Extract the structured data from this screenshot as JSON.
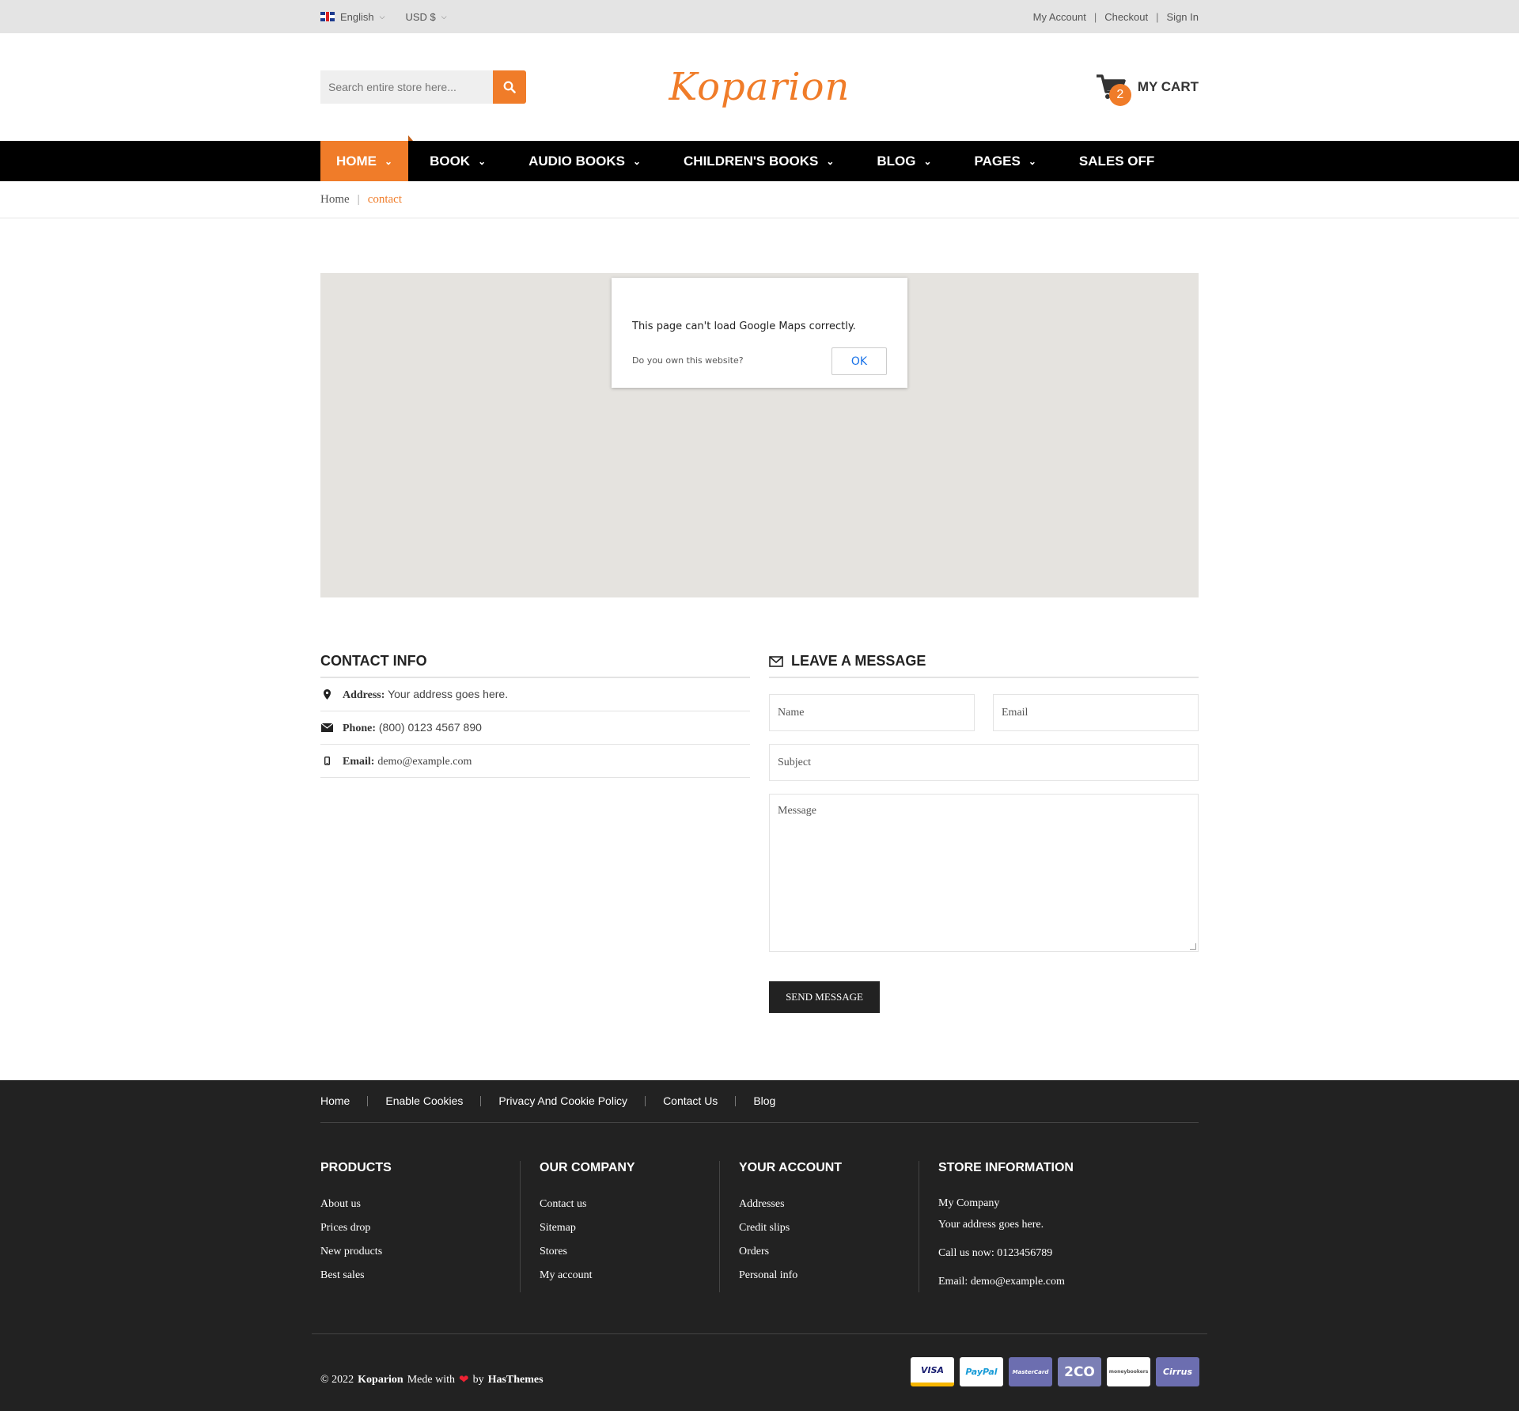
{
  "topbar": {
    "language": "English",
    "currency": "USD $",
    "links": [
      "My Account",
      "Checkout",
      "Sign In"
    ],
    "separator": "|"
  },
  "header": {
    "search_placeholder": "Search entire store here...",
    "logo": "Koparion",
    "cart_label": "MY CART",
    "cart_count": "2"
  },
  "nav": {
    "items": [
      "HOME",
      "BOOK",
      "AUDIO BOOKS",
      "CHILDREN'S BOOKS",
      "BLOG",
      "PAGES",
      "SALES OFF"
    ],
    "active": "HOME"
  },
  "breadcrumb": {
    "home": "Home",
    "separator": "|",
    "current": "contact"
  },
  "map": {
    "message": "This page can't load Google Maps correctly.",
    "own_question": "Do you own this website?",
    "ok_label": "OK"
  },
  "contact_info": {
    "title": "CONTACT INFO",
    "address_label": "Address:",
    "address_value": "Your address goes here.",
    "phone_label": "Phone:",
    "phone_value": "(800) 0123 4567 890",
    "email_label": "Email:",
    "email_value": "demo@example.com"
  },
  "message_form": {
    "title": "LEAVE A MESSAGE",
    "name_placeholder": "Name",
    "email_placeholder": "Email",
    "subject_placeholder": "Subject",
    "message_placeholder": "Message",
    "send_label": "SEND MESSAGE"
  },
  "footer": {
    "links": [
      "Home",
      "Enable Cookies",
      "Privacy And Cookie Policy",
      "Contact Us",
      "Blog"
    ],
    "products": {
      "title": "PRODUCTS",
      "items": [
        "About us",
        "Prices drop",
        "New products",
        "Best sales"
      ]
    },
    "company": {
      "title": "OUR COMPANY",
      "items": [
        "Contact us",
        "Sitemap",
        "Stores",
        "My account"
      ]
    },
    "account": {
      "title": "YOUR ACCOUNT",
      "items": [
        "Addresses",
        "Credit slips",
        "Orders",
        "Personal info"
      ]
    },
    "store": {
      "title": "STORE INFORMATION",
      "company": "My Company",
      "address": "Your address goes here.",
      "call": "Call us now: 0123456789",
      "email": "Email: demo@example.com"
    },
    "copyright": {
      "prefix": "© 2022",
      "brand": "Koparion",
      "made_with": "Mede with",
      "by": "by",
      "author": "HasThemes"
    },
    "payments": [
      "VISA",
      "PayPal",
      "MasterCard",
      "2CO",
      "moneybookers",
      "Cirrus"
    ]
  },
  "colors": {
    "accent": "#f07c29",
    "nav_bg": "#000000",
    "footer_bg": "#222222",
    "topbar_bg": "#e4e4e4",
    "map_bg": "#e5e3df"
  }
}
